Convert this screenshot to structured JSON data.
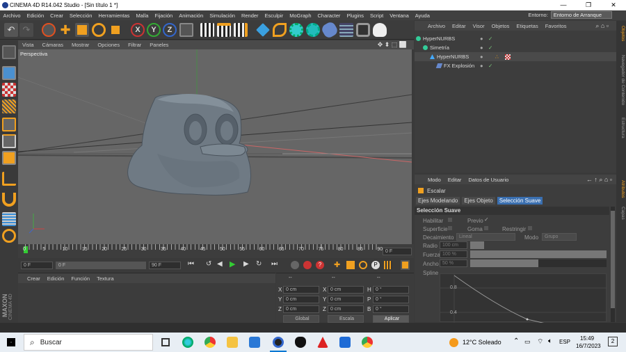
{
  "title_bar": {
    "title": "CINEMA 4D R14.042 Studio - [Sin título 1 *]",
    "minimize": "—",
    "restore": "❐",
    "close": "✕"
  },
  "menu": [
    "Archivo",
    "Edición",
    "Crear",
    "Selección",
    "Herramientas",
    "Malla",
    "Fijación",
    "Animación",
    "Simulación",
    "Render",
    "Esculpir",
    "MoGraph",
    "Character",
    "Plugins",
    "Script",
    "Ventana",
    "Ayuda"
  ],
  "environment": {
    "label": "Entorno:",
    "value": "Entorno de Arranque"
  },
  "viewport": {
    "menu": [
      "Vista",
      "Cámaras",
      "Mostrar",
      "Opciones",
      "Filtrar",
      "Paneles"
    ],
    "label": "Perspectiva"
  },
  "timeline": {
    "ticks": [
      "0",
      "5",
      "10",
      "15",
      "20",
      "25",
      "30",
      "35",
      "40",
      "45",
      "50",
      "55",
      "60",
      "65",
      "70",
      "75",
      "80",
      "85",
      "90"
    ],
    "frame": "0 F"
  },
  "transport": {
    "start": "0 F",
    "current": "0 F",
    "end": "90 F",
    "end2": "90 F"
  },
  "material_manager": {
    "menu": [
      "Crear",
      "Edición",
      "Función",
      "Textura"
    ],
    "logo_line1": "MAXON",
    "logo_line2": "CINEMA 4D"
  },
  "coordinates": {
    "header_dots": [
      "--",
      "--",
      "--"
    ],
    "rows": [
      {
        "a": "X",
        "av": "0 cm",
        "b": "X",
        "bv": "0 cm",
        "c": "H",
        "cv": "0 °"
      },
      {
        "a": "Y",
        "av": "0 cm",
        "b": "Y",
        "bv": "0 cm",
        "c": "P",
        "cv": "0 °"
      },
      {
        "a": "Z",
        "av": "0 cm",
        "b": "Z",
        "bv": "0 cm",
        "c": "B",
        "cv": "0 °"
      }
    ],
    "mode1": "Global",
    "mode2": "Escala",
    "apply": "Aplicar"
  },
  "object_manager": {
    "menu": [
      "Archivo",
      "Editar",
      "Visor",
      "Objetos",
      "Etiquetas",
      "Favoritos"
    ],
    "objects": [
      {
        "name": "HyperNURBS",
        "indent": 0
      },
      {
        "name": "Simetría",
        "indent": 1
      },
      {
        "name": "HyperNURBS",
        "indent": 2
      },
      {
        "name": "FX Explosión",
        "indent": 3
      }
    ]
  },
  "attributes": {
    "menu": [
      "Modo",
      "Editar",
      "Datos de Usuario"
    ],
    "tool": "Escalar",
    "tabs": [
      "Ejes Modelando",
      "Ejes Objeto",
      "Selección Suave"
    ],
    "section": "Selección Suave",
    "habilitar": "Habilitar",
    "previo": "Previo",
    "superficie": "Superficie",
    "goma": "Goma",
    "restringir": "Restringir",
    "decaimiento": "Decaimiento",
    "decaimiento_val": "Lineal",
    "modo": "Modo",
    "modo_val": "Grupo",
    "radio": "Radio",
    "radio_val": "100 cm",
    "fuerza": "Fuerza",
    "fuerza_val": "100 %",
    "fuerza_level": 1.0,
    "ancho": "Ancho",
    "ancho_val": "50 %",
    "ancho_level": 0.5,
    "spline": "Spline",
    "spline_y1": "0.8",
    "spline_y2": "0.4"
  },
  "side_tabs": {
    "right_top": [
      "Objetos",
      "Navegador de Contenido",
      "Estructura"
    ],
    "right_bottom": [
      "Atributos",
      "Capas"
    ]
  },
  "taskbar": {
    "search": "Buscar",
    "weather": "12°C  Soleado",
    "lang": "ESP",
    "time": "15:49",
    "date": "16/7/2023",
    "notif": "2"
  },
  "colors": {
    "accent_orange": "#f0a020",
    "tab_active": "#3a6fb0",
    "bg_panel": "#3d3d3d",
    "viewport": "#666666"
  }
}
